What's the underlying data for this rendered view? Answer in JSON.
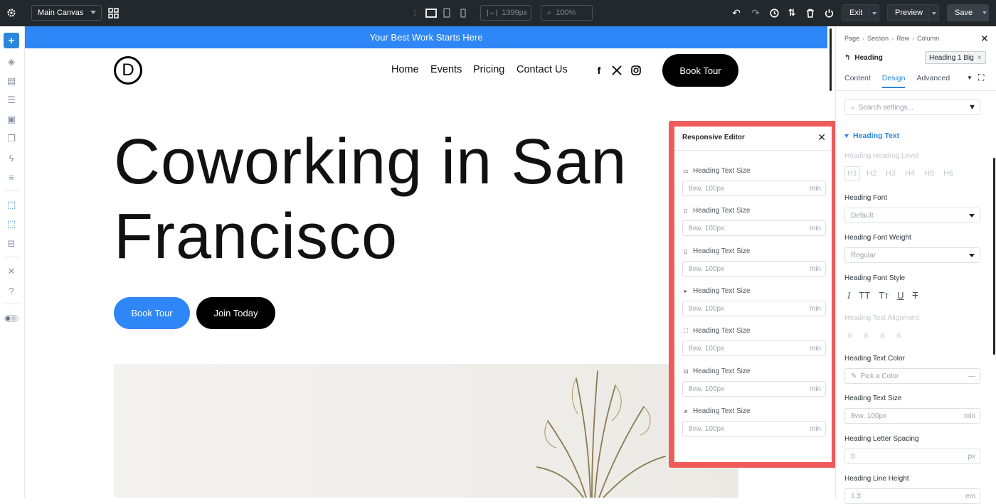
{
  "toolbar": {
    "canvas_name": "Main Canvas",
    "width_value": "1399px",
    "zoom_value": "100%",
    "exit_label": "Exit",
    "preview_label": "Preview",
    "save_label": "Save"
  },
  "banner": {
    "text": "Your Best Work Starts Here"
  },
  "site": {
    "logo_letter": "D",
    "nav": [
      "Home",
      "Events",
      "Pricing",
      "Contact Us"
    ],
    "header_button": "Book Tour",
    "hero_line1": "Coworking in San",
    "hero_line2": "Francisco",
    "cta_primary": "Book Tour",
    "cta_secondary": "Join Today"
  },
  "responsive_editor": {
    "title": "Responsive Editor",
    "rows": [
      {
        "label": "Heading Text Size",
        "placeholder": "8vw, 100px",
        "unit": "min",
        "device_icon": "desktop-icon"
      },
      {
        "label": "Heading Text Size",
        "placeholder": "8vw, 100px",
        "unit": "min",
        "device_icon": "tablet-icon"
      },
      {
        "label": "Heading Text Size",
        "placeholder": "8vw, 100px",
        "unit": "min",
        "device_icon": "tablet-narrow-icon"
      },
      {
        "label": "Heading Text Size",
        "placeholder": "8vw, 100px",
        "unit": "min",
        "device_icon": "phone-icon"
      },
      {
        "label": "Heading Text Size",
        "placeholder": "8vw, 100px",
        "unit": "min",
        "device_icon": "phone-wide-icon"
      },
      {
        "label": "Heading Text Size",
        "placeholder": "8vw, 100px",
        "unit": "min",
        "device_icon": "laptop-icon"
      },
      {
        "label": "Heading Text Size",
        "placeholder": "8vw, 100px",
        "unit": "min",
        "device_icon": "ultrawide-icon"
      }
    ]
  },
  "panel": {
    "breadcrumb": [
      "Page",
      "Section",
      "Row",
      "Column"
    ],
    "element_name": "Heading",
    "preset": "Heading 1 Big",
    "tabs": [
      "Content",
      "Design",
      "Advanced"
    ],
    "active_tab": "Design",
    "search_placeholder": "Search settings...",
    "section_title": "Heading Text",
    "heading_level_label": "Heading Heading Level",
    "heading_levels": [
      "H1",
      "H2",
      "H3",
      "H4",
      "H5",
      "H6"
    ],
    "font_label": "Heading Font",
    "font_value": "Default",
    "weight_label": "Heading Font Weight",
    "weight_value": "Regular",
    "style_label": "Heading Font Style",
    "style_buttons": [
      "I",
      "TT",
      "Tт",
      "U",
      "T"
    ],
    "alignment_label": "Heading Text Alignment",
    "color_label": "Heading Text Color",
    "color_placeholder": "Pick a Color",
    "size_label": "Heading Text Size",
    "size_placeholder": "8vw, 100px",
    "size_unit": "min",
    "spacing_label": "Heading Letter Spacing",
    "spacing_placeholder": "0",
    "spacing_unit": "px",
    "line_height_label": "Heading Line Height",
    "line_height_placeholder": "1.3",
    "line_height_unit": "em"
  },
  "colors": {
    "accent": "#2b87da",
    "banner": "#2f86f6",
    "highlight": "#ef5b5b",
    "toolbar": "#23282d"
  }
}
